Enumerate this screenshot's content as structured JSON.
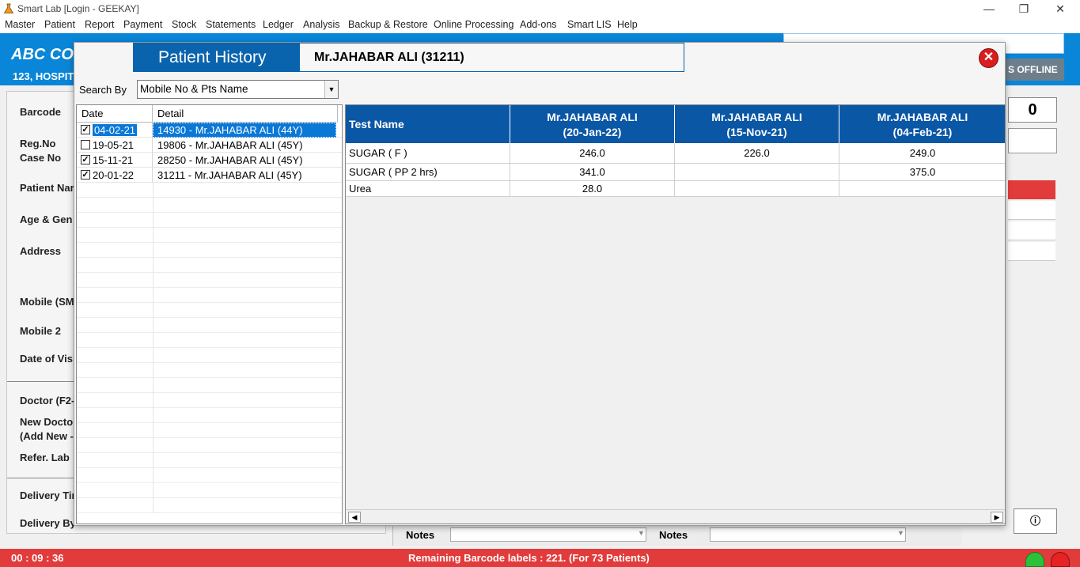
{
  "window": {
    "title": "Smart Lab [Login -  GEEKAY]",
    "controls": {
      "minimize": "—",
      "maximize": "❐",
      "close": "✕"
    }
  },
  "menu": [
    "Master",
    "Patient",
    "Report",
    "Payment",
    "Stock",
    "Statements",
    "Ledger",
    "Analysis",
    "Backup & Restore",
    "Online Processing",
    "Add-ons",
    "Smart LIS",
    "Help"
  ],
  "background": {
    "company": "ABC CO",
    "address": "123, HOSPIT",
    "offline_label": "S OFFLINE",
    "counter": "0",
    "form_labels": {
      "barcode": "Barcode",
      "reg_no": "Reg.No",
      "case_no": "Case No",
      "patient_name": "Patient Nar",
      "age_gender": "Age & Gen",
      "address": "Address",
      "mobile": "Mobile (SM",
      "mobile2": "Mobile 2",
      "date_of_visit": "Date of Visi",
      "doctor": "Doctor (F2-",
      "new_doctor": "New Docto",
      "add_new": "(Add New -",
      "refer_lab": "Refer. Lab",
      "delivery_time": "Delivery Tir",
      "delivery_by": "Delivery By"
    },
    "notes_label_1": "Notes",
    "notes_label_2": "Notes",
    "info_button": "ⓘ"
  },
  "status_bar": {
    "timer": "00 : 09 : 36",
    "message": "Remaining Barcode labels : 221. (For 73 Patients)"
  },
  "dialog": {
    "title": "Patient History",
    "patient": "Mr.JAHABAR ALI (31211)",
    "close_glyph": "✕",
    "search_label": "Search By",
    "search_value": "Mobile No & Pts Name",
    "list_headers": {
      "date": "Date",
      "detail": "Detail"
    },
    "visits": [
      {
        "date": "04-02-21",
        "detail": "14930 - Mr.JAHABAR ALI (44Y)",
        "checked": true,
        "selected": true
      },
      {
        "date": "19-05-21",
        "detail": "19806 - Mr.JAHABAR ALI (45Y)",
        "checked": false,
        "selected": false
      },
      {
        "date": "15-11-21",
        "detail": "28250 - Mr.JAHABAR ALI (45Y)",
        "checked": true,
        "selected": false
      },
      {
        "date": "20-01-22",
        "detail": "31211 - Mr.JAHABAR ALI (45Y)",
        "checked": true,
        "selected": false
      }
    ],
    "grid": {
      "test_header": "Test Name",
      "columns": [
        {
          "name": "Mr.JAHABAR ALI",
          "date": "(20-Jan-22)"
        },
        {
          "name": "Mr.JAHABAR ALI",
          "date": "(15-Nov-21)"
        },
        {
          "name": "Mr.JAHABAR ALI",
          "date": "(04-Feb-21)"
        }
      ],
      "rows": [
        {
          "test": "SUGAR ( F )",
          "values": [
            "246.0",
            "226.0",
            "249.0"
          ]
        },
        {
          "test": "SUGAR ( PP 2 hrs)",
          "values": [
            "341.0",
            "",
            "375.0"
          ]
        },
        {
          "test": "Urea",
          "values": [
            "28.0",
            "",
            ""
          ]
        }
      ]
    }
  }
}
